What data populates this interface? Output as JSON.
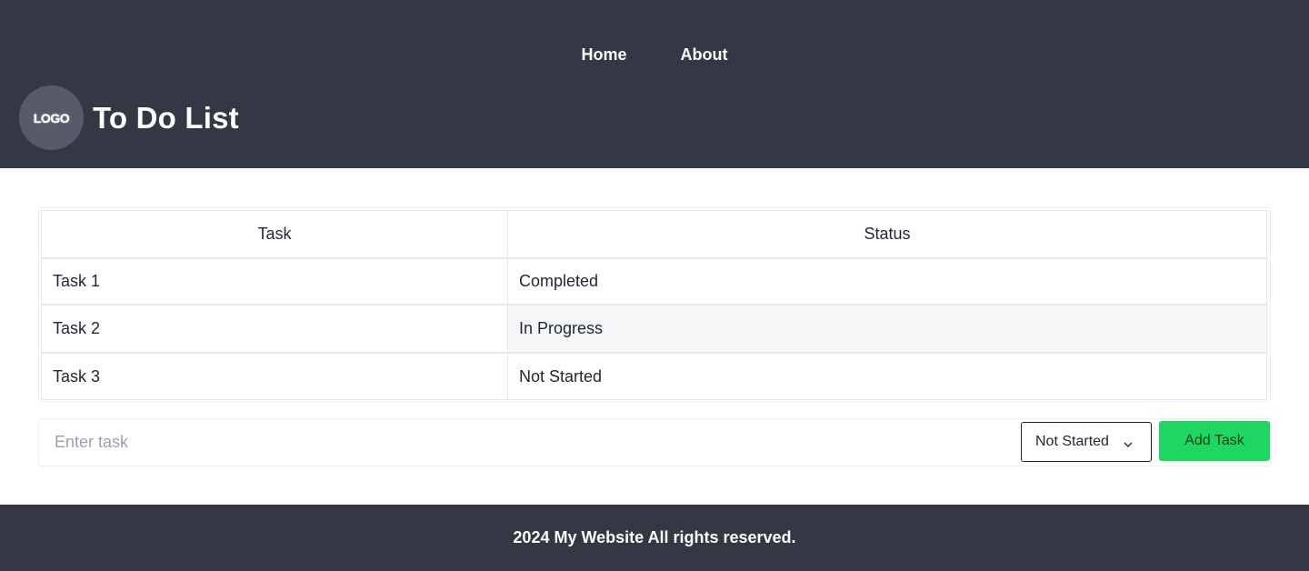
{
  "header": {
    "nav": [
      {
        "label": "Home"
      },
      {
        "label": "About"
      }
    ],
    "logo_text": "LOGO",
    "title": "To Do List"
  },
  "table": {
    "columns": [
      "Task",
      "Status"
    ],
    "rows": [
      {
        "task": "Task 1",
        "status": "Completed"
      },
      {
        "task": "Task 2",
        "status": "In Progress"
      },
      {
        "task": "Task 3",
        "status": "Not Started"
      }
    ]
  },
  "form": {
    "task_placeholder": "Enter task",
    "task_value": "",
    "status_selected": "Not Started",
    "add_label": "Add Task"
  },
  "footer": {
    "text": "2024 My Website All rights reserved."
  },
  "colors": {
    "header_bg": "#343744",
    "accent_green": "#1ed760",
    "logo_bg": "#575a69"
  },
  "icons": {
    "select_arrow": "chevron-down-icon"
  }
}
